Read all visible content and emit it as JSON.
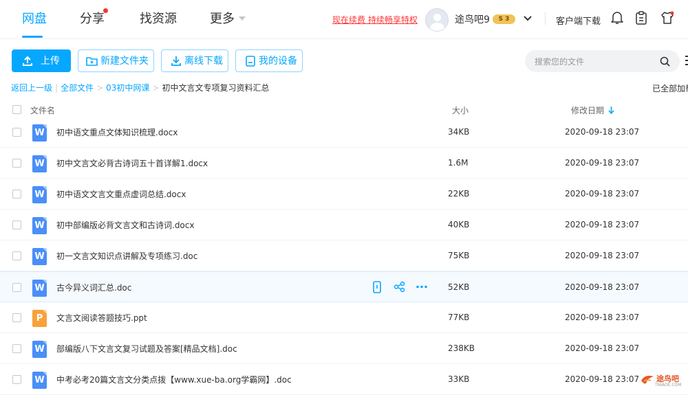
{
  "nav": {
    "items": [
      {
        "label": "网盘",
        "active": true
      },
      {
        "label": "分享",
        "active": false
      },
      {
        "label": "找资源",
        "active": false
      },
      {
        "label": "更多",
        "active": false
      }
    ],
    "promo": "现在续费 持续畅享特权",
    "username": "途鸟吧9",
    "vip_badge": "S 3",
    "client_download": "客户端下载"
  },
  "toolbar": {
    "upload": "上传",
    "new_folder": "新建文件夹",
    "offline_download": "离线下载",
    "my_devices": "我的设备"
  },
  "search": {
    "placeholder": "搜索您的文件"
  },
  "breadcrumb": {
    "back": "返回上一级",
    "root": "全部文件",
    "parent": "03初中网课",
    "current": "初中文言文专项复习资料汇总"
  },
  "loaded_text": "已全部加载",
  "table": {
    "headers": {
      "name": "文件名",
      "size": "大小",
      "date": "修改日期"
    },
    "rows": [
      {
        "type": "word",
        "icon_letter": "W",
        "name": "初中语文重点文体知识梳理.docx",
        "size": "34KB",
        "date": "2020-09-18 23:07"
      },
      {
        "type": "word",
        "icon_letter": "W",
        "name": "初中文言文必背古诗词五十首详解1.docx",
        "size": "1.6M",
        "date": "2020-09-18 23:07"
      },
      {
        "type": "word",
        "icon_letter": "W",
        "name": "初中语文文言文重点虚词总结.docx",
        "size": "22KB",
        "date": "2020-09-18 23:07"
      },
      {
        "type": "word",
        "icon_letter": "W",
        "name": "初中部编版必背文言文和古诗词.docx",
        "size": "40KB",
        "date": "2020-09-18 23:07"
      },
      {
        "type": "word",
        "icon_letter": "W",
        "name": "初一文言文知识点讲解及专项练习.doc",
        "size": "75KB",
        "date": "2020-09-18 23:07"
      },
      {
        "type": "word",
        "icon_letter": "W",
        "name": "古今异义词汇总.doc",
        "size": "52KB",
        "date": "2020-09-18 23:07",
        "hovered": true
      },
      {
        "type": "ppt",
        "icon_letter": "P",
        "name": "文言文阅读答题技巧.ppt",
        "size": "77KB",
        "date": "2020-09-18 23:07"
      },
      {
        "type": "word",
        "icon_letter": "W",
        "name": "部编版八下文言文复习试题及答案[精品文档].doc",
        "size": "238KB",
        "date": "2020-09-18 23:07"
      },
      {
        "type": "word",
        "icon_letter": "W",
        "name": "中考必考20篇文言文分类点拨【www.xue-ba.org学霸网】.doc",
        "size": "33KB",
        "date": "2020-09-18 23:07"
      }
    ]
  },
  "watermark": {
    "text": "途鸟吧",
    "sub": "TNIAOE.COM"
  },
  "colors": {
    "accent": "#06a7ff",
    "promo": "#ff3333",
    "word_icon": "#4a8ff7",
    "ppt_icon": "#f7a23b"
  }
}
